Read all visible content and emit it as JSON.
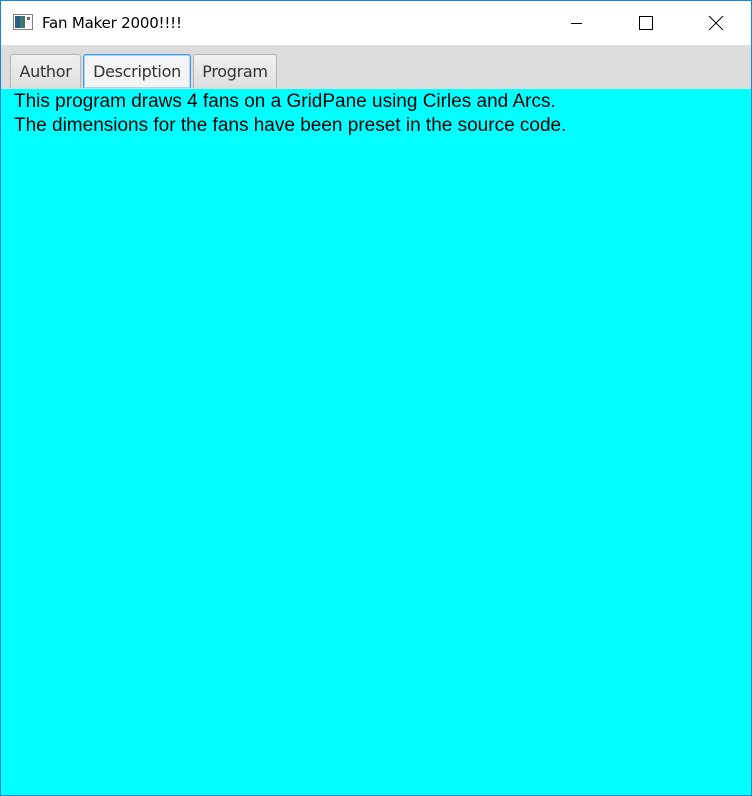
{
  "window": {
    "title": "Fan Maker 2000!!!!",
    "accent_border": "#1883d7"
  },
  "caption_buttons": {
    "minimize_icon": "minimize-icon",
    "maximize_icon": "maximize-icon",
    "close_icon": "close-icon"
  },
  "tabs": [
    {
      "label": "Author",
      "selected": false
    },
    {
      "label": "Description",
      "selected": true
    },
    {
      "label": "Program",
      "selected": false
    }
  ],
  "content": {
    "background": "#00ffff",
    "lines": [
      "This program draws 4 fans on a GridPane using Cirles and Arcs.",
      "The dimensions for the fans have been preset in the source code."
    ]
  }
}
